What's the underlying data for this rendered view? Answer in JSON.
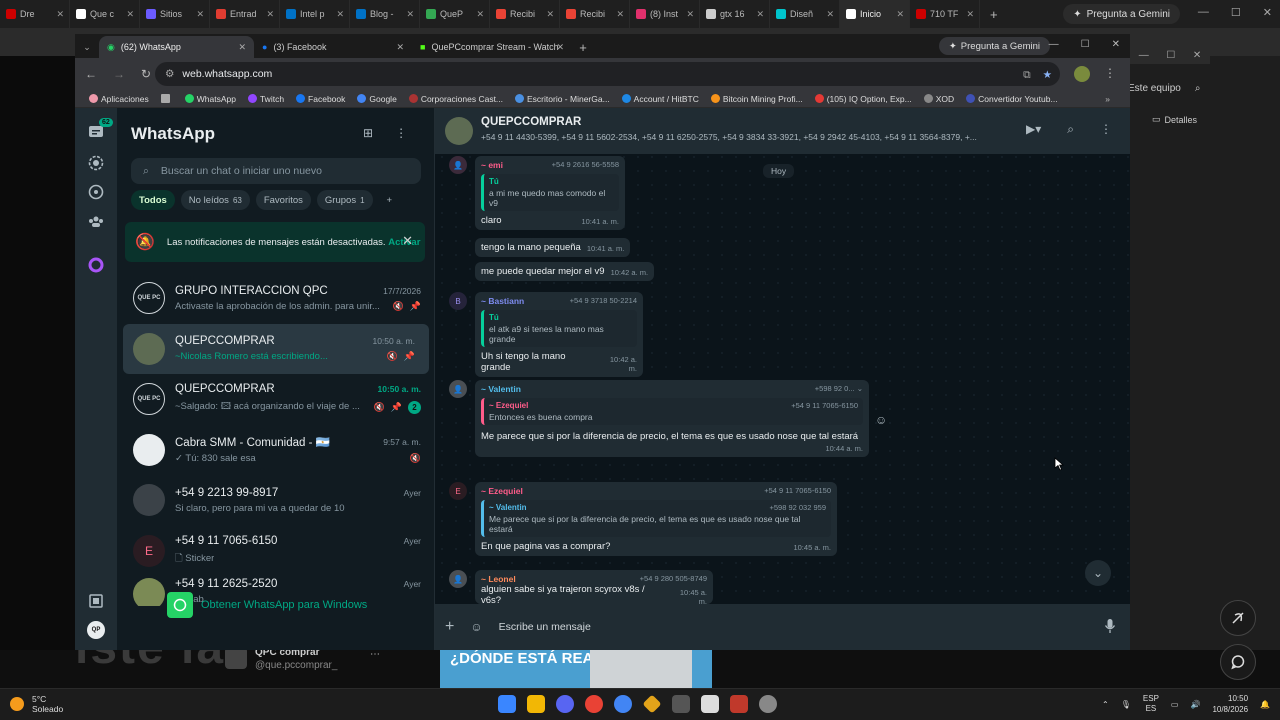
{
  "outer_tabs": [
    "Dre",
    "Que c",
    "Sitios",
    "Entrad",
    "Intel p",
    "Blog -",
    "QueP",
    "Recibi",
    "Recibi",
    "(8) Inst",
    "gtx 16",
    "Diseñ",
    "Inicio",
    "710 TF"
  ],
  "outer_gemini": "Pregunta a Gemini",
  "inner_tabs": [
    {
      "label": "(62) WhatsApp"
    },
    {
      "label": "(3) Facebook"
    },
    {
      "label": "QuePCcomprar Stream - Watch"
    }
  ],
  "inner_gemini": "Pregunta a Gemini",
  "url": "web.whatsapp.com",
  "bookmarks": [
    "Aplicaciones",
    "",
    "WhatsApp",
    "Twitch",
    "Facebook",
    "Google",
    "Corporaciones Cast...",
    "Escritorio - MinerGa...",
    "Account / HitBTC",
    "Bitcoin Mining Profi...",
    "(105) IQ Option, Exp...",
    "XOD",
    "Convertidor Youtub..."
  ],
  "bg": {
    "search": "Este equipo",
    "detalles": "Detalles",
    "bigtext": "iste la",
    "yt_title": "QPC comprar",
    "yt_sub": "@que.pccomprar_",
    "thumb_text": "¿DÓNDE ESTÁ REALMENTE LA"
  },
  "rail": {
    "badge": "62"
  },
  "sidebar": {
    "title": "WhatsApp",
    "search_placeholder": "Buscar un chat o iniciar uno nuevo",
    "filters": [
      {
        "label": "Todos",
        "count": ""
      },
      {
        "label": "No leídos",
        "count": "63"
      },
      {
        "label": "Favoritos",
        "count": ""
      },
      {
        "label": "Grupos",
        "count": "1"
      }
    ],
    "notif_text": "Las notificaciones de mensajes están desactivadas.",
    "notif_link": "Activar",
    "get_wa": "Obtener WhatsApp para Windows"
  },
  "chats": [
    {
      "name": "GRUPO INTERACCION QPC",
      "time": "17/7/2026",
      "preview": "Activaste la aprobación de los admin. para unir...",
      "av": "QUE PC"
    },
    {
      "name": "QUEPCCOMPRAR",
      "time": "10:50 a. m.",
      "preview": "~Nicolas Romero está escribiendo...",
      "av": ""
    },
    {
      "name": "QUEPCCOMPRAR",
      "time": "10:50 a. m.",
      "preview": "~Salgado: 🖾 acá organizando el viaje de ...",
      "av": "QUE PC",
      "badge": "2"
    },
    {
      "name": "Cabra SMM - Comunidad - 🇦🇷",
      "time": "9:57 a. m.",
      "preview": "✓ Tú: 830 sale esa",
      "av": ""
    },
    {
      "name": "+54 9 2213 99-8917",
      "time": "Ayer",
      "preview": "Si claro, pero para mi va a quedar de 10",
      "av": ""
    },
    {
      "name": "+54 9 11 7065-6150",
      "time": "Ayer",
      "preview": "🗋 Sticker",
      "av": "E"
    },
    {
      "name": "+54 9 11 2625-2520",
      "time": "Ayer",
      "preview": "~ chab",
      "av": ""
    }
  ],
  "conversation": {
    "name": "QUEPCCOMPRAR",
    "members": "+54 9 11 4430-5399, +54 9 11 5602-2534, +54 9 11 6250-2575, +54 9 3834 33-3921, +54 9 2942 45-4103, +54 9 11 3564-8379, +...",
    "today": "Hoy",
    "composer_placeholder": "Escribe un mensaje"
  },
  "messages": {
    "m1": {
      "sender": "~ emi",
      "phone": "+54 9 2616 56-5558",
      "q_sender": "Tú",
      "q_text": "a mi me quedo  mas comodo el  v9",
      "text": "claro",
      "ts": "10:41 a. m."
    },
    "m2": {
      "text": "tengo la mano pequeña",
      "ts": "10:41 a. m."
    },
    "m3": {
      "text": "me puede quedar mejor el v9",
      "ts": "10:42 a. m."
    },
    "m4": {
      "av": "B",
      "sender": "~ Bastiann",
      "phone": "+54 9 3718 50-2214",
      "q_sender": "Tú",
      "q_text": "el atk a9 si tenes la mano mas grande",
      "text": "Uh si tengo la mano grande",
      "ts": "10:42 a. m."
    },
    "m5": {
      "sender": "~ Valentin",
      "phone": "+598 92 0...",
      "q_sender": "~ Ezequiel",
      "q_phone": "+54 9 11 7065-6150",
      "q_text": "Entonces es buena compra",
      "text": "Me parece que si por la diferencia de precio, el tema es que es usado nose que tal estará",
      "ts": "10:44 a. m."
    },
    "m6": {
      "av": "E",
      "sender": "~ Ezequiel",
      "phone": "+54 9 11 7065-6150",
      "q_sender": "~ Valentin",
      "q_phone": "+598 92 032 959",
      "q_text": "Me parece que si por la diferencia de precio, el tema es que es usado nose que tal estará",
      "text": "En que pagina vas a comprar?",
      "ts": "10:45 a. m."
    },
    "m7": {
      "sender": "~ Leonel",
      "phone": "+54 9 280 505-8749",
      "text": "alguien sabe si ya trajeron scyrox v8s / v6s?",
      "ts": "10:45 a. m."
    }
  },
  "taskbar": {
    "temp": "5°C",
    "weather": "Soleado",
    "lang1": "ESP",
    "lang2": "ES",
    "time": "10:50",
    "date": "10/8/2026"
  }
}
